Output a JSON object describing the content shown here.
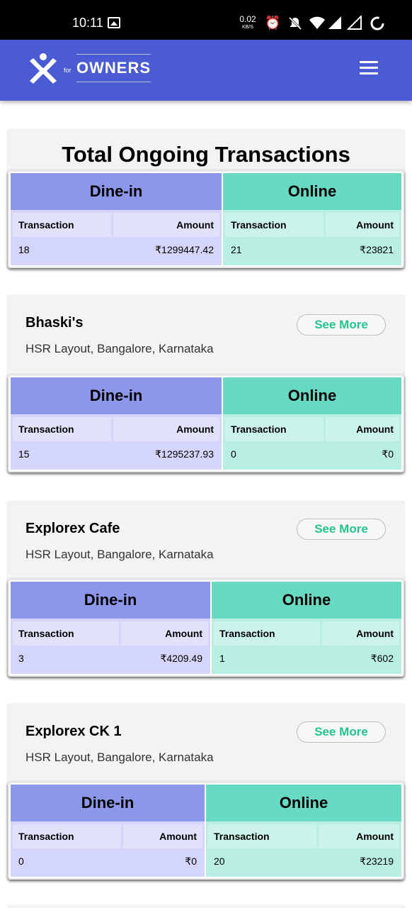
{
  "status_bar": {
    "time": "10:11",
    "net_speed": "0.02",
    "net_unit": "KB/S",
    "icons": [
      "gallery-icon",
      "alarm-icon",
      "mute-icon",
      "wifi-icon",
      "signal-icon",
      "signal-roaming-icon",
      "battery-icon"
    ]
  },
  "app_bar": {
    "logo_for": "for",
    "brand": "OWNERS",
    "menu_icon": "hamburger-menu-icon"
  },
  "total": {
    "title": "Total Ongoing Transactions",
    "dine_in": {
      "label": "Dine-in",
      "col_transaction": "Transaction",
      "col_amount": "Amount",
      "transaction": "18",
      "amount": "₹1299447.42"
    },
    "online": {
      "label": "Online",
      "col_transaction": "Transaction",
      "col_amount": "Amount",
      "transaction": "21",
      "amount": "₹23821"
    }
  },
  "restaurants": [
    {
      "name": "Bhaski's",
      "address": "HSR Layout, Bangalore, Karnataka",
      "see_more": "See More",
      "dine_in": {
        "label": "Dine-in",
        "col_transaction": "Transaction",
        "col_amount": "Amount",
        "transaction": "15",
        "amount": "₹1295237.93"
      },
      "online": {
        "label": "Online",
        "col_transaction": "Transaction",
        "col_amount": "Amount",
        "transaction": "0",
        "amount": "₹0"
      }
    },
    {
      "name": "Explorex Cafe",
      "address": "HSR Layout, Bangalore, Karnataka",
      "see_more": "See More",
      "dine_in": {
        "label": "Dine-in",
        "col_transaction": "Transaction",
        "col_amount": "Amount",
        "transaction": "3",
        "amount": "₹4209.49"
      },
      "online": {
        "label": "Online",
        "col_transaction": "Transaction",
        "col_amount": "Amount",
        "transaction": "1",
        "amount": "₹602"
      }
    },
    {
      "name": "Explorex CK 1",
      "address": "HSR Layout, Bangalore, Karnataka",
      "see_more": "See More",
      "dine_in": {
        "label": "Dine-in",
        "col_transaction": "Transaction",
        "col_amount": "Amount",
        "transaction": "0",
        "amount": "₹0"
      },
      "online": {
        "label": "Online",
        "col_transaction": "Transaction",
        "col_amount": "Amount",
        "transaction": "20",
        "amount": "₹23219"
      }
    }
  ],
  "colors": {
    "app_bar": "#4a5bd4",
    "dine_in_header": "#8c97ea",
    "online_header": "#68d9c3",
    "see_more_text": "#24c392"
  }
}
